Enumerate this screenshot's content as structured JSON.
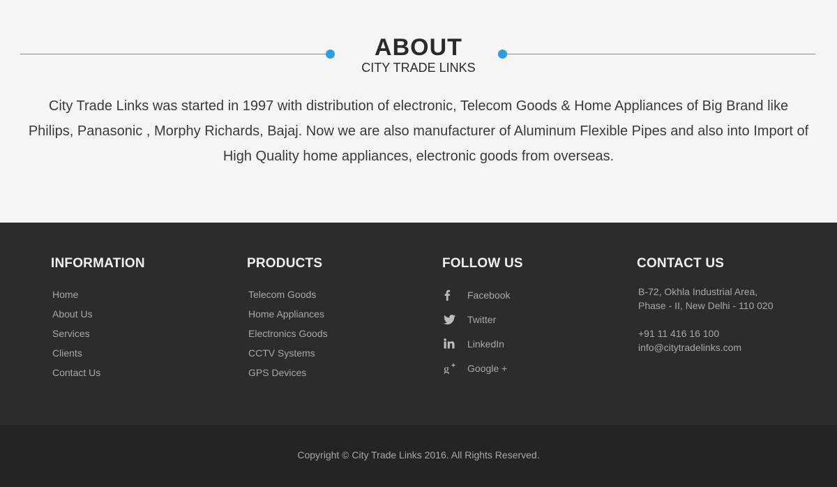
{
  "about": {
    "title": "ABOUT",
    "subtitle": "CITY TRADE LINKS",
    "body": "City Trade Links was started in 1997 with distribution of electronic, Telecom Goods & Home Appliances of Big Brand like Philips, Panasonic , Morphy Richards, Bajaj. Now we are also manufacturer of Aluminum Flexible Pipes and also into Import of High Quality home appliances, electronic goods from overseas."
  },
  "footer": {
    "information": {
      "heading": "INFORMATION",
      "links": [
        "Home",
        "About Us",
        "Services",
        "Clients",
        "Contact Us"
      ]
    },
    "products": {
      "heading": "PRODUCTS",
      "links": [
        "Telecom Goods",
        "Home Appliances",
        "Electronics Goods",
        "CCTV Systems",
        "GPS Devices"
      ]
    },
    "follow": {
      "heading": "FOLLOW US",
      "items": [
        {
          "label": "Facebook",
          "icon": "facebook-icon"
        },
        {
          "label": "Twitter",
          "icon": "twitter-icon"
        },
        {
          "label": "LinkedIn",
          "icon": "linkedin-icon"
        },
        {
          "label": "Google +",
          "icon": "google-plus-icon"
        }
      ]
    },
    "contact": {
      "heading": "CONTACT US",
      "address_line1": "B-72, Okhla Industrial Area,",
      "address_line2": "Phase - II, New Delhi - 110 020",
      "phone": "+91 11 416 16 100",
      "email": "info@citytradelinks.com"
    }
  },
  "copyright": "Copyright © City Trade Links 2016. All Rights Reserved.",
  "colors": {
    "accent": "#2b9fe0",
    "footer_bg": "#2d2b2b",
    "bottom_bg": "#252323"
  }
}
